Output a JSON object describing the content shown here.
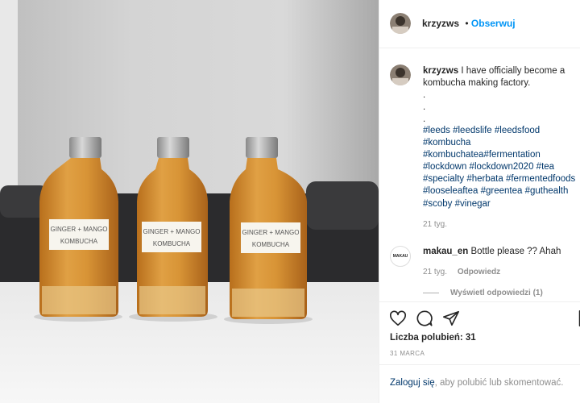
{
  "header": {
    "username": "krzyzws",
    "dot": "•",
    "follow_label": "Obserwuj"
  },
  "caption": {
    "username": "krzyzws",
    "line1": "I have officially become a",
    "line2": "kombucha making factory.",
    "dots": [
      ".",
      ".",
      "."
    ],
    "hashtags": [
      [
        "#leeds",
        "#leedslife",
        "#leedsfood"
      ],
      [
        "#kombucha"
      ],
      [
        "#kombuchatea",
        "#fermentation"
      ],
      [
        "#lockdown",
        "#lockdown2020",
        "#tea"
      ],
      [
        "#specialty",
        "#herbata",
        "#fermentedfoods"
      ],
      [
        "#looseleaftea",
        "#greentea",
        "#guthealth"
      ],
      [
        "#scoby",
        "#vinegar"
      ]
    ],
    "time": "21 tyg."
  },
  "comment": {
    "username": "makau_en",
    "avatar_text": "MAKAU",
    "text": "Bottle please ?? Ahah",
    "time": "21 tyg.",
    "reply_label": "Odpowiedz",
    "view_replies": "Wyświetl odpowiedzi (1)"
  },
  "actions": {
    "like_icon": "heart-icon",
    "comment_icon": "comment-icon",
    "share_icon": "share-icon",
    "likes_label": "Liczba polubień: 31",
    "date": "31 MARCA"
  },
  "footer": {
    "login_link": "Zaloguj się",
    "login_rest": ", aby polubić lub skomentować."
  },
  "photo": {
    "bottle_label_line1": "GINGER + MANGO",
    "bottle_label_line2": "KOMBUCHA"
  }
}
